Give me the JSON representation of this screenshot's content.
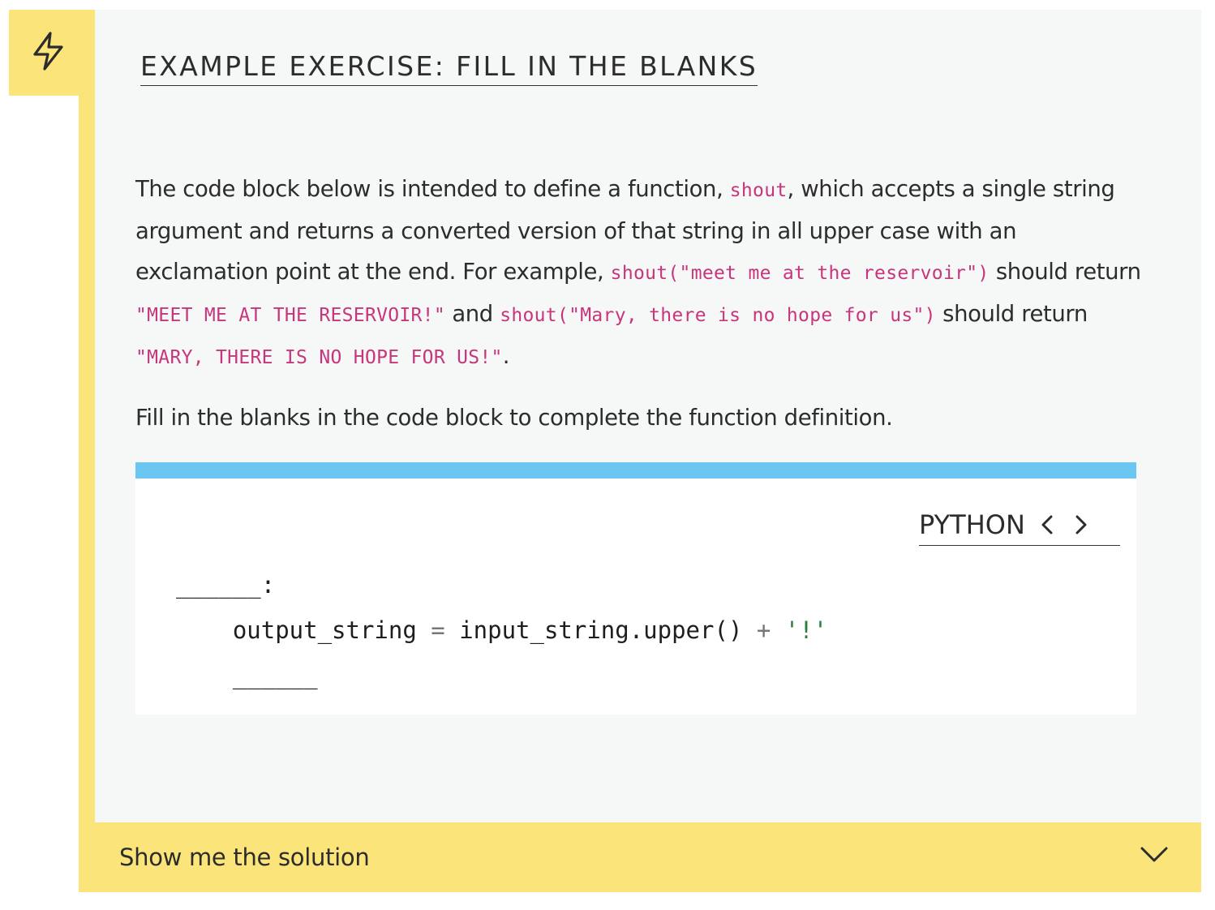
{
  "exercise": {
    "title": "EXAMPLE EXERCISE: FILL IN THE BLANKS",
    "icon": "lightning-bolt-icon",
    "paragraph1": {
      "t1": "The code block below is intended to define a function, ",
      "c1": "shout",
      "t2": ", which accepts a single string argument and returns a converted version of that string in all upper case with an exclamation point at the end. For example, ",
      "c2": "shout(\"meet me at the reservoir\")",
      "t3": " should return ",
      "c3": "\"MEET ME AT THE RESERVOIR!\"",
      "t4": " and ",
      "c4": "shout(\"Mary, there is no hope for us\")",
      "t5": " should return ",
      "c5": "\"MARY, THERE IS NO HOPE FOR US!\"",
      "t6": "."
    },
    "paragraph2": "Fill in the blanks in the code block to complete the function definition."
  },
  "code_block": {
    "language": "PYTHON",
    "line1": "______:",
    "line2_var": "    output_string ",
    "line2_op": "=",
    "line2_expr": " input_string.upper() ",
    "line2_plus": "+",
    "line2_sp": " ",
    "line2_str": "'!'",
    "line3": "    ______",
    "accent_color": "#6bc6f2"
  },
  "solution": {
    "label": "Show me the solution",
    "icon": "chevron-down-icon"
  },
  "colors": {
    "accent_yellow": "#fbe57b",
    "inline_code": "#c7367d"
  }
}
